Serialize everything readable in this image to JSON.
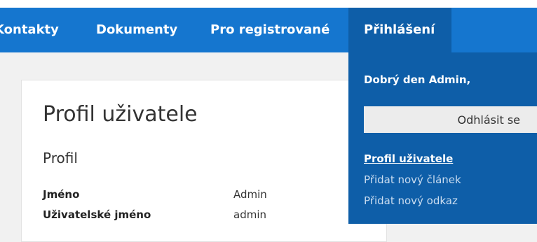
{
  "nav": {
    "items": [
      {
        "label": "Kontakty"
      },
      {
        "label": "Dokumenty"
      },
      {
        "label": "Pro registrované"
      },
      {
        "label": "Přihlášení"
      }
    ]
  },
  "profile": {
    "title": "Profil uživatele",
    "section": "Profil",
    "fields": [
      {
        "label": "Jméno",
        "value": "Admin"
      },
      {
        "label": "Uživatelské jméno",
        "value": "admin"
      }
    ]
  },
  "dropdown": {
    "greeting": "Dobrý den Admin,",
    "logout_label": "Odhlásit se",
    "links": [
      {
        "label": "Profil uživatele"
      },
      {
        "label": "Přidat nový článek"
      },
      {
        "label": "Přidat nový odkaz"
      }
    ]
  },
  "colors": {
    "nav_bg": "#1576cf",
    "nav_active_bg": "#0e5ea8",
    "page_bg": "#f1f1f1",
    "card_bg": "#ffffff",
    "button_bg": "#ececec"
  }
}
